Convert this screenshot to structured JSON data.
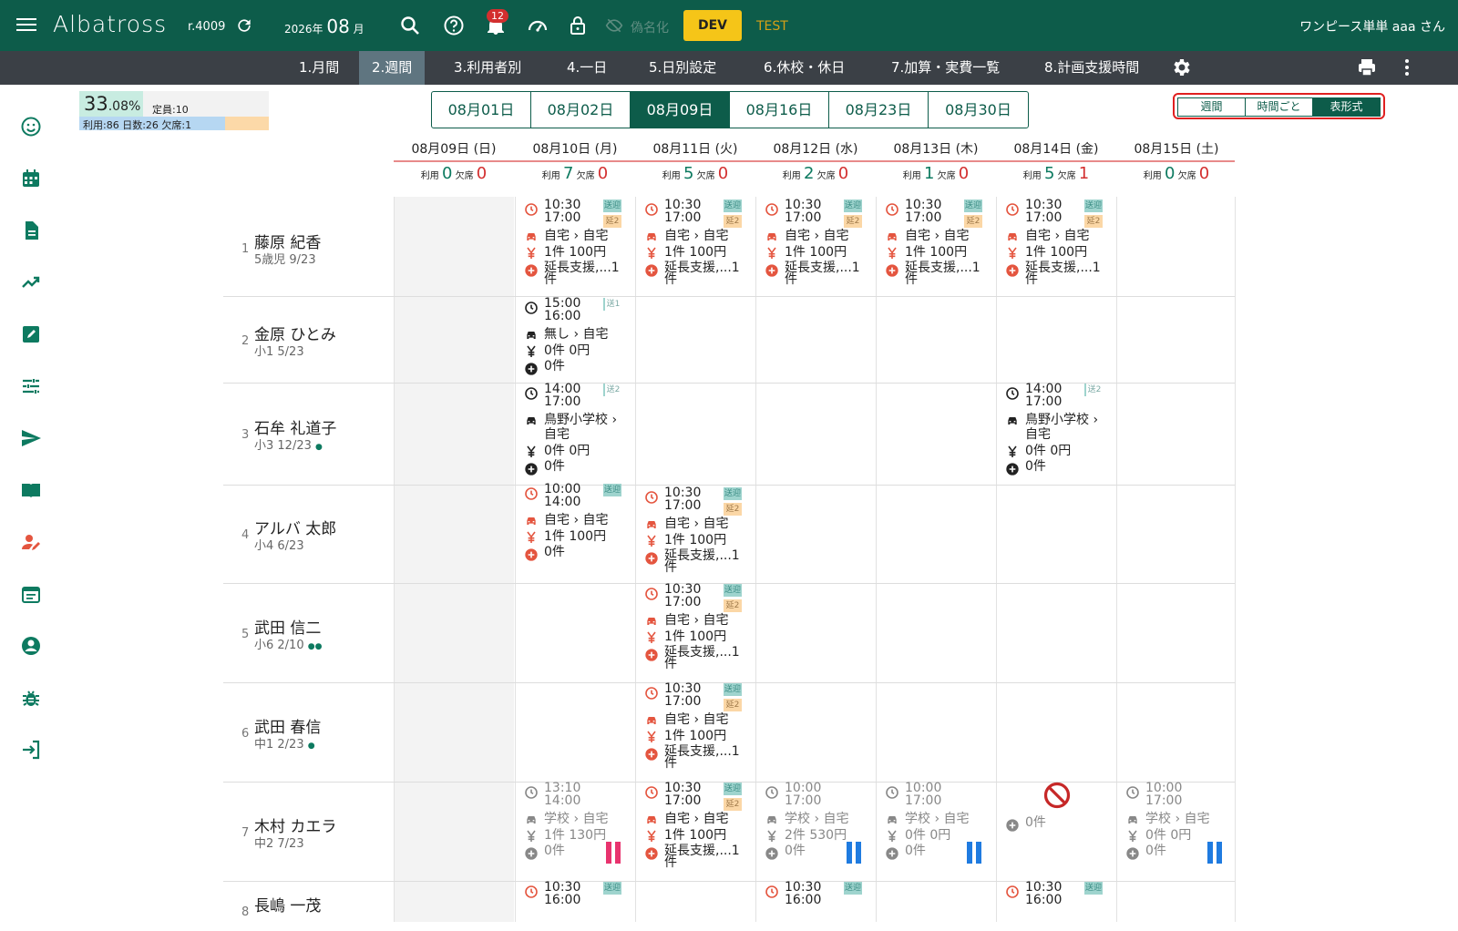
{
  "header": {
    "app_title": "Albatross",
    "version": "r.4009",
    "year": "2026年",
    "month": "08",
    "month_unit": "月",
    "notification_count": "12",
    "anon_label": "偽名化",
    "dev_label": "DEV",
    "test_label": "TEST",
    "user": "ワンピース単単 aaa さん"
  },
  "tabs": [
    "1.月間",
    "2.週間",
    "3.利用者別",
    "4.一日",
    "5.日別設定",
    "6.休校・休日",
    "7.加算・実費一覧",
    "8.計画支援時間"
  ],
  "summary": {
    "pct_main": "33",
    "pct_decimal": ".08%",
    "capacity": "定員:10",
    "stats": "利用:86 日数:26 欠席:1"
  },
  "date_tabs": [
    "08月01日",
    "08月02日",
    "08月09日",
    "08月16日",
    "08月23日",
    "08月30日"
  ],
  "view_toggle": [
    "週間",
    "時間ごと",
    "表形式"
  ],
  "days": [
    {
      "label": "08月09日 (日)",
      "use": "0",
      "absent": "0"
    },
    {
      "label": "08月10日 (月)",
      "use": "7",
      "absent": "0"
    },
    {
      "label": "08月11日 (火)",
      "use": "5",
      "absent": "0"
    },
    {
      "label": "08月12日 (水)",
      "use": "2",
      "absent": "0"
    },
    {
      "label": "08月13日 (木)",
      "use": "1",
      "absent": "0"
    },
    {
      "label": "08月14日 (金)",
      "use": "5",
      "absent": "1"
    },
    {
      "label": "08月15日 (土)",
      "use": "0",
      "absent": "0"
    }
  ],
  "count_labels": {
    "use": "利用",
    "absent": "欠席"
  },
  "people": [
    {
      "idx": "1",
      "name": "藤原 紀香",
      "sub": "5歳児 9/23",
      "dots": ""
    },
    {
      "idx": "2",
      "name": "金原 ひとみ",
      "sub": "小1 5/23",
      "dots": ""
    },
    {
      "idx": "3",
      "name": "石牟 礼道子",
      "sub": "小3 12/23",
      "dots": "●"
    },
    {
      "idx": "4",
      "name": "アルバ 太郎",
      "sub": "小4 6/23",
      "dots": ""
    },
    {
      "idx": "5",
      "name": "武田 信二",
      "sub": "小6 2/10",
      "dots": "●●"
    },
    {
      "idx": "6",
      "name": "武田 春信",
      "sub": "中1 2/23",
      "dots": "●"
    },
    {
      "idx": "7",
      "name": "木村 カエラ",
      "sub": "中2 7/23",
      "dots": ""
    },
    {
      "idx": "8",
      "name": "長嶋 一茂",
      "sub": "",
      "dots": ""
    }
  ],
  "cells": {
    "std": {
      "start": "10:30",
      "end": "17:00",
      "route": "自宅 › 自宅",
      "fee": "1件 100円",
      "extra": "延長支援,...1",
      "extra2": "件",
      "tag1": "送迎",
      "tag2": "延2"
    },
    "p2": {
      "start": "15:00",
      "end": "16:00",
      "route": "無し › 自宅",
      "fee": "0件 0円",
      "extra": "0件",
      "tag1": "送1"
    },
    "p3": {
      "start": "14:00",
      "end": "17:00",
      "route": "鳥野小学校 ›",
      "route2": "自宅",
      "fee": "0件 0円",
      "extra": "0件",
      "tag1": "送2"
    },
    "p4a": {
      "start": "10:00",
      "end": "14:00",
      "route": "自宅 › 自宅",
      "fee": "1件 100円",
      "extra": "0件",
      "tag1": "送迎"
    },
    "p7a": {
      "start": "13:10",
      "end": "14:00",
      "route": "学校 › 自宅",
      "fee": "1件 130円",
      "extra": "0件"
    },
    "p7c": {
      "start": "10:00",
      "end": "17:00",
      "route": "学校 › 自宅",
      "fee": "2件 530円",
      "extra": "0件"
    },
    "p7d": {
      "start": "10:00",
      "end": "17:00",
      "route": "学校 › 自宅",
      "fee": "0件 0円",
      "extra": "0件"
    },
    "p7e": {
      "extra": "0件"
    },
    "p8a": {
      "start": "10:30",
      "end": "16:00",
      "tag1": "送迎"
    }
  },
  "colors": {
    "primary": "#0d5c4a",
    "accent_red": "#e4553f",
    "pause_pink": "#e8336e",
    "pause_blue": "#1f7be0"
  }
}
